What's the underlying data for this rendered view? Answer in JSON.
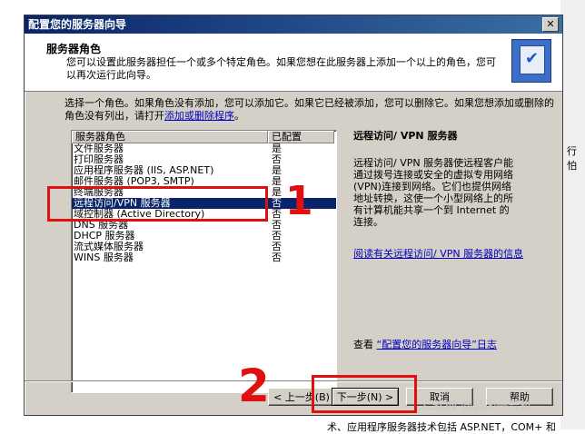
{
  "window": {
    "title": "配置您的服务器向导",
    "close_icon": "close-icon"
  },
  "header": {
    "title": "服务器角色",
    "description": "您可以设置此服务器担任一个或多个特定角色。如果您想在此服务器上添加一个以上的角色，您可以再次运行此向导。",
    "icon": "server-wizard-icon"
  },
  "intro": {
    "text_before_link": "选择一个角色。如果角色没有添加，您可以添加它。如果它已经被添加，您可以删除它。如果您想添加或删除的角色没有列出，请打开",
    "link_text": "添加或删除程序",
    "text_after_link": "。"
  },
  "roles_table": {
    "columns": [
      "服务器角色",
      "已配置"
    ],
    "rows": [
      {
        "role": "文件服务器",
        "configured": "是"
      },
      {
        "role": "打印服务器",
        "configured": "否"
      },
      {
        "role": "应用程序服务器 (IIS, ASP.NET)",
        "configured": "是"
      },
      {
        "role": "邮件服务器 (POP3, SMTP)",
        "configured": "是"
      },
      {
        "role": "终端服务器",
        "configured": "是"
      },
      {
        "role": "远程访问/VPN 服务器",
        "configured": "否",
        "selected": true
      },
      {
        "role": "域控制器 (Active Directory)",
        "configured": "否"
      },
      {
        "role": "DNS 服务器",
        "configured": "否"
      },
      {
        "role": "DHCP 服务器",
        "configured": "否"
      },
      {
        "role": "流式媒体服务器",
        "configured": "否"
      },
      {
        "role": "WINS 服务器",
        "configured": "否"
      }
    ]
  },
  "detail": {
    "title": "远程访问/ VPN 服务器",
    "body": "远程访问/ VPN 服务器使远程客户能通过拨号连接或安全的虚拟专用网络(VPN)连接到网络。它们也提供网络地址转换，这使一个小型网络上的所有计算机能共享一个到 Internet 的连接。",
    "link": "阅读有关远程访问/ VPN 服务器的信息",
    "log_prefix": "查看",
    "log_link": "“配置您的服务器向导”日志"
  },
  "buttons": {
    "back": "< 上一步(B)",
    "next": "下一步(N) >",
    "cancel": "取消",
    "help": "帮助"
  },
  "annotations": {
    "number_1": "1",
    "number_2": "2"
  },
  "background": {
    "right_text": "行怕",
    "bottom_text": "术、应用程序服务器技术包括 ASP.NET，COM+ 和"
  },
  "watermark": "CSDN @轻闲一号机",
  "colors": {
    "title_bar": "#0a246a",
    "selection": "#0a246a",
    "annotation_red": "#e01010",
    "link_blue": "#0000c0"
  }
}
